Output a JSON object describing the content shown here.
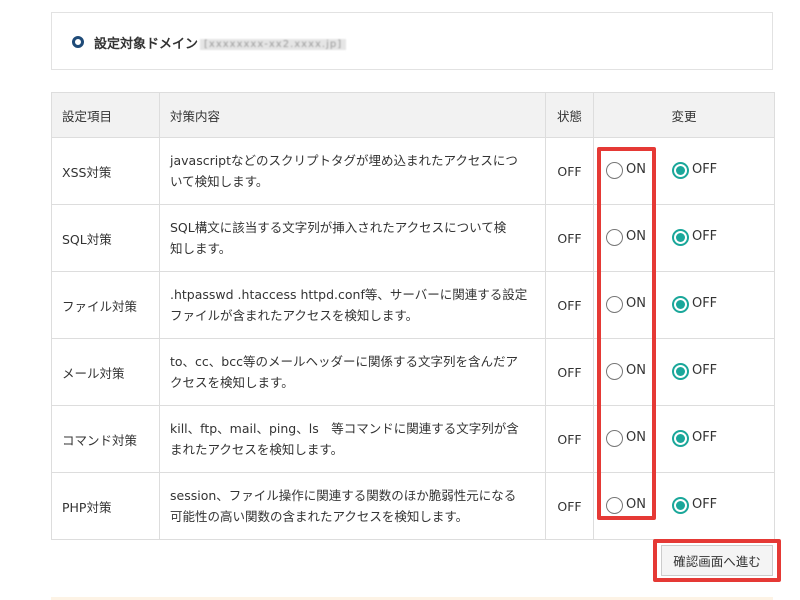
{
  "domain": {
    "label": "設定対象ドメイン",
    "value": "[xxxxxxxx-xx2.xxxx.jp]"
  },
  "table": {
    "headers": [
      "設定項目",
      "対策内容",
      "状態",
      "変更"
    ],
    "radio_on_label": "ON",
    "radio_off_label": "OFF",
    "rows": [
      {
        "name": "XSS対策",
        "desc_line1": "javascriptなどのスクリプトタグが埋め込まれたアクセスにつ",
        "desc_line2": "いて検知します。",
        "state": "OFF",
        "selected": "OFF"
      },
      {
        "name": "SQL対策",
        "desc_line1": "SQL構文に該当する文字列が挿入されたアクセスについて検",
        "desc_line2": "知します。",
        "state": "OFF",
        "selected": "OFF"
      },
      {
        "name": "ファイル対策",
        "desc_line1": ".htpasswd .htaccess httpd.conf等、サーバーに関連する設定",
        "desc_line2": "ファイルが含まれたアクセスを検知します。",
        "state": "OFF",
        "selected": "OFF"
      },
      {
        "name": "メール対策",
        "desc_line1": "to、cc、bcc等のメールヘッダーに関係する文字列を含んだア",
        "desc_line2": "クセスを検知します。",
        "state": "OFF",
        "selected": "OFF"
      },
      {
        "name": "コマンド対策",
        "desc_line1": "kill、ftp、mail、ping、ls　等コマンドに関連する文字列が含",
        "desc_line2": "まれたアクセスを検知します。",
        "state": "OFF",
        "selected": "OFF"
      },
      {
        "name": "PHP対策",
        "desc_line1": "session、ファイル操作に関連する関数のほか脆弱性元になる",
        "desc_line2": "可能性の高い関数の含まれたアクセスを検知します。",
        "state": "OFF",
        "selected": "OFF"
      }
    ]
  },
  "submit_label": "確認画面へ進む",
  "colors": {
    "radio_checked": "#1aa79a",
    "highlight": "#e53935",
    "domain_icon": "#1f4b78",
    "header_bg": "#f2f2f2"
  }
}
